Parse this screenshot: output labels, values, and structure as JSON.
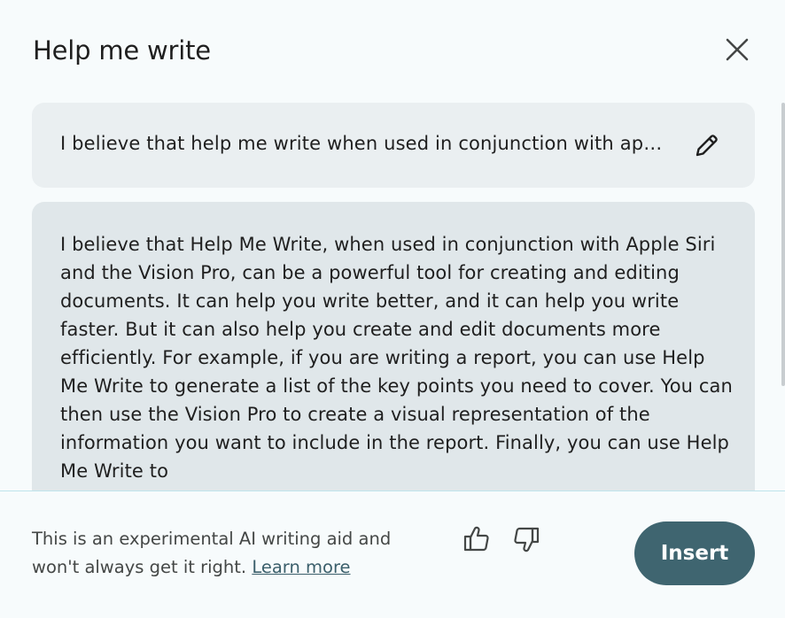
{
  "dialog": {
    "title": "Help me write"
  },
  "prompt": {
    "text": "I believe that help me write when used in conjunction with apple siri and the vision pro can be a powerful tool for creating and editing documents"
  },
  "response": {
    "text": "I believe that Help Me Write, when used in conjunction with Apple Siri and the Vision Pro, can be a powerful tool for creating and editing documents. It can help you write better, and it can help you write faster. But it can also help you create and edit documents more efficiently. For example, if you are writing a report, you can use Help Me Write to generate a list of the key points you need to cover. You can then use the Vision Pro to create a visual representation of the information you want to include in the report. Finally, you can use Help Me Write to"
  },
  "footer": {
    "disclaimer": "This is an experimental AI writing aid and won't always get it right.",
    "learn_more": "Learn more",
    "insert_label": "Insert"
  },
  "icons": {
    "close": "close-icon",
    "edit": "pencil-icon",
    "thumb_up": "thumb-up-icon",
    "thumb_down": "thumb-down-icon"
  },
  "colors": {
    "background": "#f7fbfc",
    "prompt_bg": "#eaeff1",
    "response_bg": "#e0e7ea",
    "insert_bg": "#3f6570",
    "link": "#3b5f6b",
    "divider": "#bfe3ec"
  }
}
